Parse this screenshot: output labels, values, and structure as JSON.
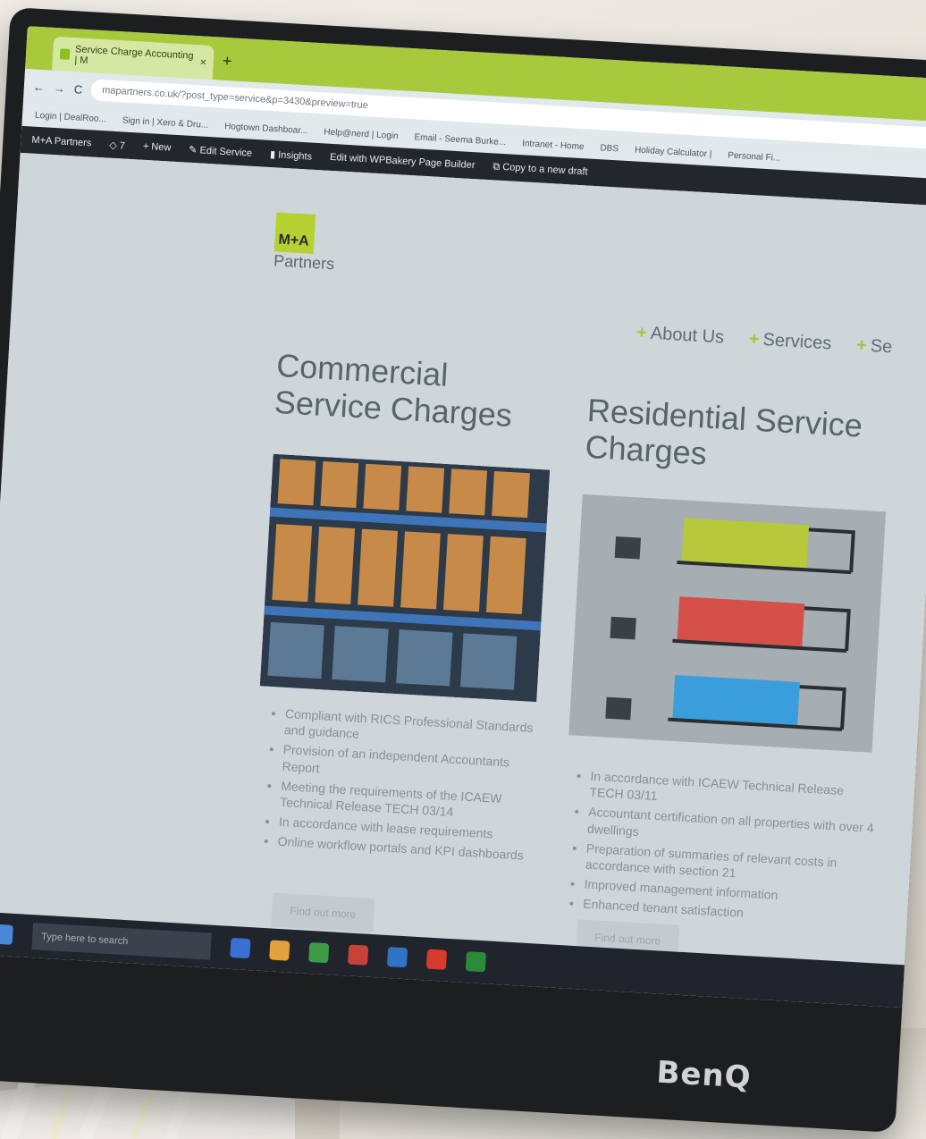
{
  "browser": {
    "tab_title": "Service Charge Accounting | M",
    "tab_close": "×",
    "new_tab": "+",
    "url": "mapartners.co.uk/?post_type=service&p=3430&preview=true",
    "nav_back": "←",
    "nav_forward": "→",
    "nav_reload": "C",
    "bookmarks": [
      "Login | DealRoo...",
      "Sign in | Xero & Dru...",
      "Hogtown Dashboar...",
      "Help@nerd | Login",
      "Email - Seema Burke...",
      "Intranet - Home",
      "DBS",
      "Holiday Calculator |",
      "Personal Fi..."
    ]
  },
  "admin_bar": {
    "site": "M+A Partners",
    "comments": "7",
    "new": "New",
    "edit": "Edit Service",
    "insights": "Insights",
    "builder": "Edit with WPBakery Page Builder",
    "copy": "Copy to a new draft"
  },
  "brand": {
    "mark": "M+A",
    "name": "Partners"
  },
  "nav": {
    "items": [
      "About Us",
      "Services",
      "Se"
    ],
    "plus": "+"
  },
  "commercial": {
    "title": "Commercial Service Charges",
    "bullets": [
      "Compliant with RICS Professional Standards and guidance",
      "Provision of an independent Accountants Report",
      "Meeting the requirements of the ICAEW Technical Release TECH 03/14",
      "In accordance with lease requirements",
      "Online workflow portals and KPI dashboards"
    ],
    "button": "Find out more"
  },
  "residential": {
    "title": "Residential Service Charges",
    "bullets": [
      "In accordance with ICAEW Technical Release TECH 03/11",
      "Accountant certification on all properties with over 4 dwellings",
      "Preparation of summaries of relevant costs in accordance with section 21",
      "Improved management information",
      "Enhanced tenant satisfaction"
    ],
    "button": "Find out more"
  },
  "taskbar": {
    "search": "Type here to search"
  },
  "monitor": {
    "brand": "BenQ"
  },
  "colors": {
    "accent": "#b7d032",
    "tabbar": "#a9c93c",
    "admin": "#23272b"
  }
}
